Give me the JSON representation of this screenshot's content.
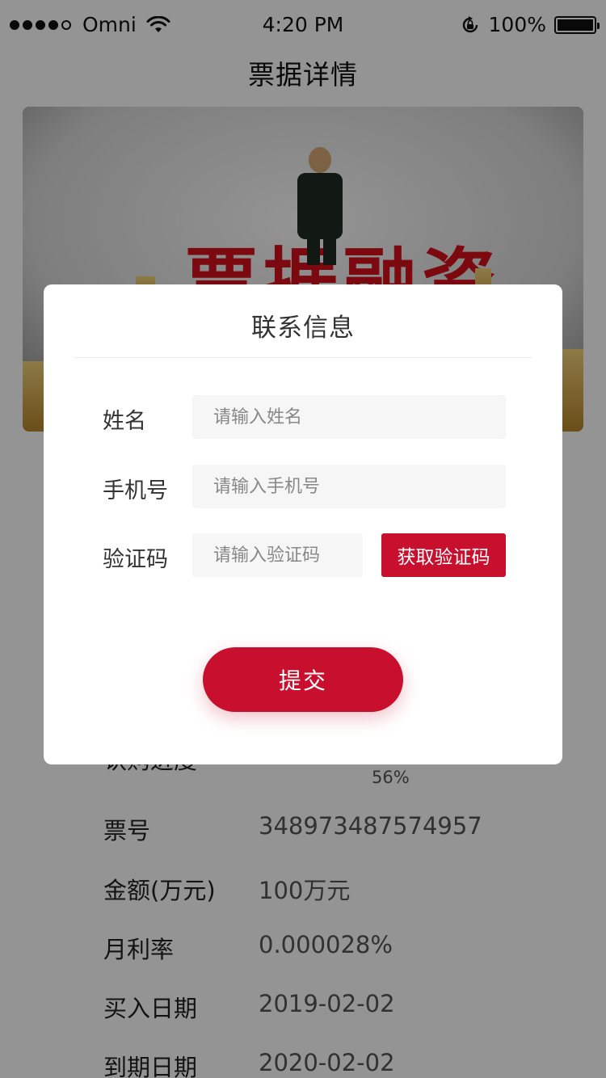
{
  "status_bar": {
    "carrier": "Omni",
    "time": "4:20 PM",
    "battery": "100%"
  },
  "page": {
    "title": "票据详情"
  },
  "details": {
    "progress_label": "认购进度",
    "progress_value": "56%",
    "progress_fraction": 0.56,
    "rows": [
      {
        "label": "票号",
        "value": "348973487574957"
      },
      {
        "label": "金额(万元)",
        "value": "100万元"
      },
      {
        "label": "月利率",
        "value": "0.000028%"
      },
      {
        "label": "买入日期",
        "value": "2019-02-02"
      },
      {
        "label": "到期日期",
        "value": "2020-02-02"
      }
    ]
  },
  "banner": {
    "image_text": "票据融资"
  },
  "modal": {
    "title": "联系信息",
    "name_label": "姓名",
    "name_placeholder": "请输入姓名",
    "phone_label": "手机号",
    "phone_placeholder": "请输入手机号",
    "code_label": "验证码",
    "code_placeholder": "请输入验证码",
    "get_code_button": "获取验证码",
    "submit_button": "提交"
  },
  "colors": {
    "accent": "#c8102e",
    "overlay": "rgba(0,0,0,0.42)"
  }
}
